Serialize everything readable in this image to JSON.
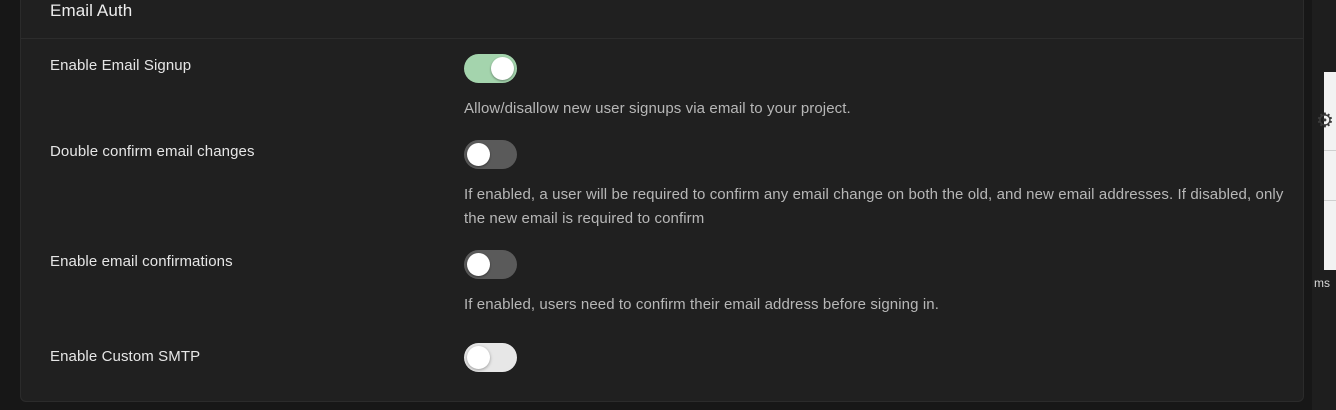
{
  "section": {
    "title": "Email Auth"
  },
  "settings": [
    {
      "label": "Enable Email Signup",
      "enabled": true,
      "description": "Allow/disallow new user signups via email to your project."
    },
    {
      "label": "Double confirm email changes",
      "enabled": false,
      "description": "If enabled, a user will be required to confirm any email change on both the old, and new email addresses. If disabled, only the new email is required to confirm"
    },
    {
      "label": "Enable email confirmations",
      "enabled": false,
      "description": "If enabled, users need to confirm their email address before signing in."
    },
    {
      "label": "Enable Custom SMTP",
      "enabled": false,
      "description": ""
    }
  ],
  "background_window": {
    "text_fragment": "ms",
    "icons": [
      "gear-icon"
    ]
  },
  "colors": {
    "toggle_on": "#a4d4ad",
    "toggle_off": "#5a5a5a",
    "card_bg": "#202020",
    "page_bg": "#171717"
  }
}
